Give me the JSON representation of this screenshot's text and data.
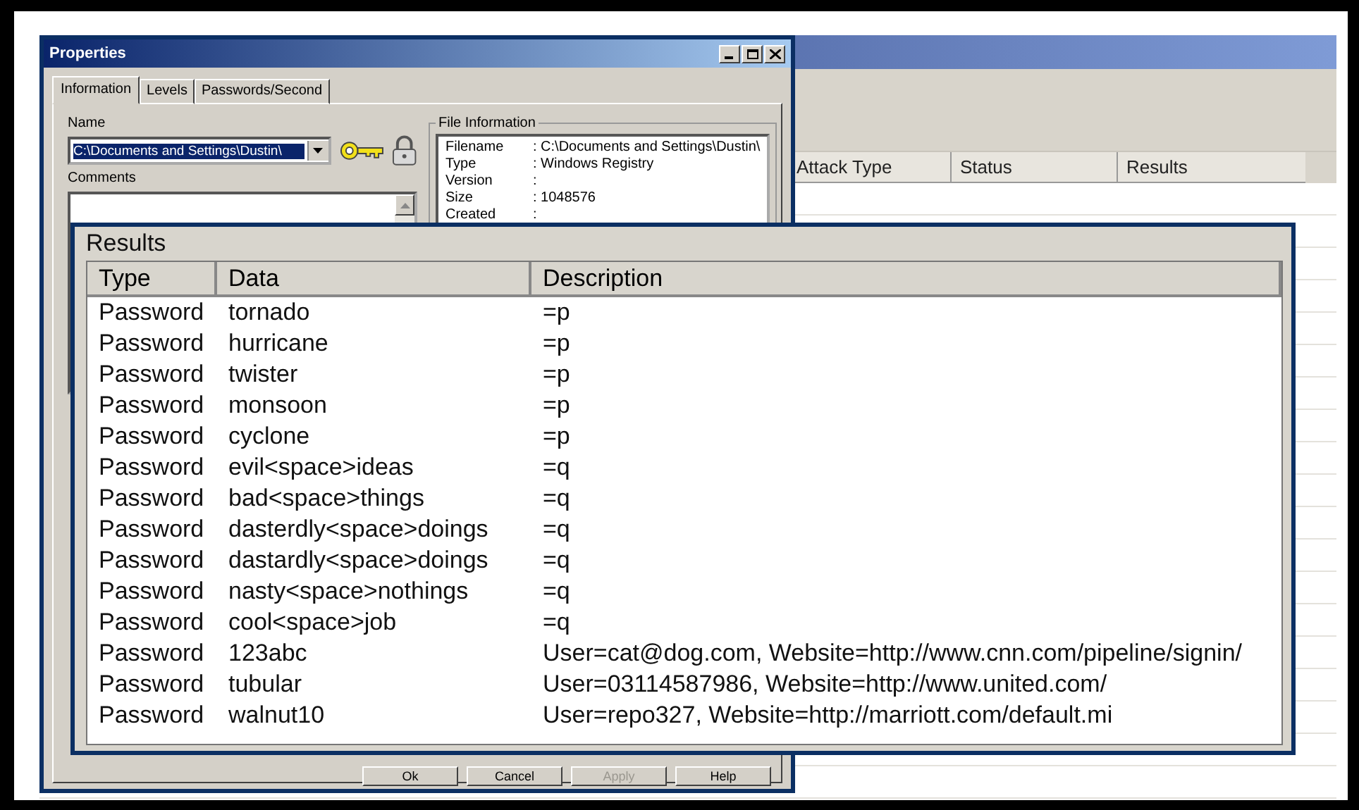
{
  "background_window": {
    "table": {
      "columns": [
        "Attack Type",
        "Status",
        "Results"
      ]
    }
  },
  "properties_dialog": {
    "title": "Properties",
    "tabs": [
      {
        "label": "Information",
        "selected": true
      },
      {
        "label": "Levels",
        "selected": false
      },
      {
        "label": "Passwords/Second",
        "selected": false
      }
    ],
    "name_label": "Name",
    "name_value": "C:\\Documents and Settings\\Dustin\\",
    "comments_label": "Comments",
    "file_information": {
      "title": "File Information",
      "fields": [
        {
          "label": "Filename",
          "value": ": C:\\Documents and Settings\\Dustin\\"
        },
        {
          "label": "Type",
          "value": ": Windows Registry"
        },
        {
          "label": "Version",
          "value": ":"
        },
        {
          "label": "Size",
          "value": ": 1048576"
        },
        {
          "label": "Created",
          "value": ":"
        }
      ]
    },
    "buttons": [
      {
        "label": "Ok",
        "disabled": false
      },
      {
        "label": "Cancel",
        "disabled": false
      },
      {
        "label": "Apply",
        "disabled": true
      },
      {
        "label": "Help",
        "disabled": false
      }
    ]
  },
  "results": {
    "title": "Results",
    "columns": [
      "Type",
      "Data",
      "Description"
    ],
    "rows": [
      {
        "type": "Password",
        "data": "tornado",
        "description": "=p"
      },
      {
        "type": "Password",
        "data": "hurricane",
        "description": "=p"
      },
      {
        "type": "Password",
        "data": "twister",
        "description": "=p"
      },
      {
        "type": "Password",
        "data": "monsoon",
        "description": "=p"
      },
      {
        "type": "Password",
        "data": "cyclone",
        "description": "=p"
      },
      {
        "type": "Password",
        "data": "evil<space>ideas",
        "description": "=q"
      },
      {
        "type": "Password",
        "data": "bad<space>things",
        "description": "=q"
      },
      {
        "type": "Password",
        "data": "dasterdly<space>doings",
        "description": "=q"
      },
      {
        "type": "Password",
        "data": "dastardly<space>doings",
        "description": "=q"
      },
      {
        "type": "Password",
        "data": "nasty<space>nothings",
        "description": "=q"
      },
      {
        "type": "Password",
        "data": "cool<space>job",
        "description": "=q"
      },
      {
        "type": "Password",
        "data": "123abc",
        "description": "User=cat@dog.com, Website=http://www.cnn.com/pipeline/signin/"
      },
      {
        "type": "Password",
        "data": "tubular",
        "description": "User=03114587986, Website=http://www.united.com/"
      },
      {
        "type": "Password",
        "data": "walnut10",
        "description": "User=repo327, Website=http://marriott.com/default.mi"
      }
    ]
  }
}
